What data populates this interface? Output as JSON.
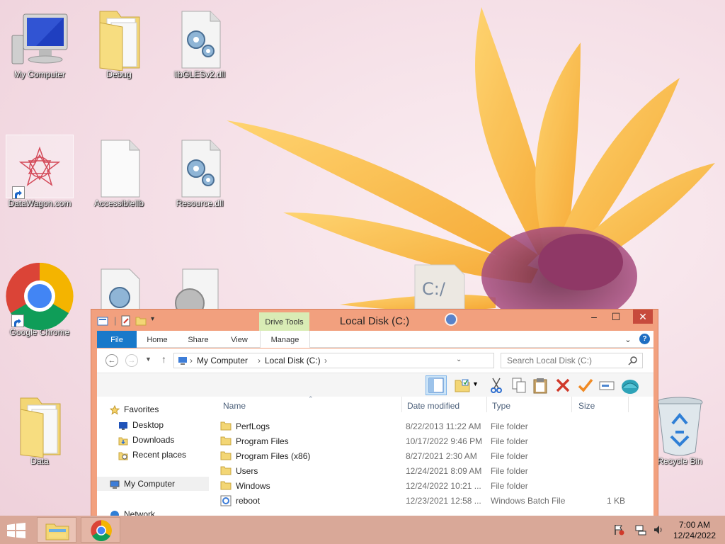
{
  "desktop": {
    "icons": [
      {
        "label": "My Computer"
      },
      {
        "label": "Debug"
      },
      {
        "label": "libGLESv2.dll"
      },
      {
        "label": "DataWagon.com"
      },
      {
        "label": "AccessibleIlb"
      },
      {
        "label": "Resource.dll"
      },
      {
        "label": "Google Chrome"
      },
      {
        "label": "Data"
      },
      {
        "label": "Recycle Bin"
      }
    ],
    "drag_item": {
      "label": "C:/"
    }
  },
  "explorer": {
    "title": "Local Disk (C:)",
    "context_tab": "Drive Tools",
    "tabs": {
      "file": "File",
      "home": "Home",
      "share": "Share",
      "view": "View",
      "manage": "Manage"
    },
    "help": "?",
    "address": {
      "root": "My Computer",
      "current": "Local Disk (C:)"
    },
    "search": {
      "placeholder": "Search Local Disk (C:)"
    },
    "nav": {
      "favorites": "Favorites",
      "desktop": "Desktop",
      "downloads": "Downloads",
      "recent": "Recent places",
      "my_computer": "My Computer",
      "network": "Network"
    },
    "columns": {
      "name": "Name",
      "date": "Date modified",
      "type": "Type",
      "size": "Size"
    },
    "files": [
      {
        "name": "PerfLogs",
        "date": "8/22/2013 11:22 AM",
        "type": "File folder",
        "size": "",
        "icon": "folder-icon"
      },
      {
        "name": "Program Files",
        "date": "10/17/2022 9:46 PM",
        "type": "File folder",
        "size": "",
        "icon": "folder-icon"
      },
      {
        "name": "Program Files (x86)",
        "date": "8/27/2021 2:30 AM",
        "type": "File folder",
        "size": "",
        "icon": "folder-icon"
      },
      {
        "name": "Users",
        "date": "12/24/2021 8:09 AM",
        "type": "File folder",
        "size": "",
        "icon": "folder-icon"
      },
      {
        "name": "Windows",
        "date": "12/24/2022 10:21 ...",
        "type": "File folder",
        "size": "",
        "icon": "folder-icon"
      },
      {
        "name": "reboot",
        "date": "12/23/2021 12:58 ...",
        "type": "Windows Batch File",
        "size": "1 KB",
        "icon": "batch-file-icon"
      }
    ]
  },
  "taskbar": {
    "time": "7:00 AM",
    "date": "12/24/2022"
  },
  "colors": {
    "window_frame": "#f2a07e",
    "file_tab": "#1979ca",
    "drive_tools": "#d9ecb5",
    "taskbar": "#d9a898",
    "close_button": "#c74a3c"
  }
}
